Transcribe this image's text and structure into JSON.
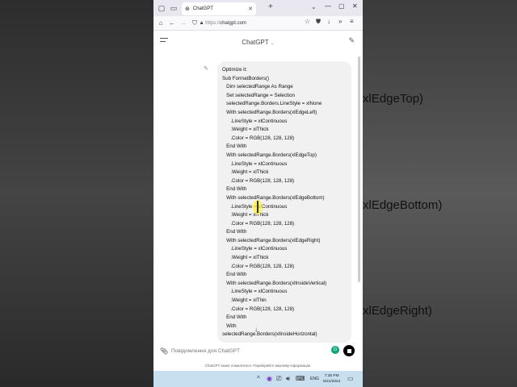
{
  "background": {
    "texts": [
      "xlEdgeTop)",
      "xlEdgeBottom)",
      "xlEdgeRight)"
    ]
  },
  "browser": {
    "tab_title": "ChatGPT",
    "url_scheme": "https://",
    "url_host": "chatgpt.com"
  },
  "chat": {
    "title": "ChatGPT",
    "message_lines": [
      "Optimize it:",
      "Sub FormatBorders()",
      "   Dim selectedRange As Range",
      "   Set selectedRange = Selection",
      "   selectedRange.Borders.LineStyle = xlNone",
      "   With selectedRange.Borders(xlEdgeLeft)",
      "      .LineStyle = xlContinuous",
      "      .Weight = xlThick",
      "      .Color = RGB(128, 128, 128)",
      "   End With",
      "   With selectedRange.Borders(xlEdgeTop)",
      "      .LineStyle = xlContinuous",
      "      .Weight = xlThick",
      "      .Color = RGB(128, 128, 128)",
      "   End With",
      "   With selectedRange.Borders(xlEdgeBottom)",
      "      .LineStyle = xlContinuous",
      "      .Weight = xlThick",
      "      .Color = RGB(128, 128, 128)",
      "   End With",
      "   With selectedRange.Borders(xlEdgeRight)",
      "      .LineStyle = xlContinuous",
      "      .Weight = xlThick",
      "      .Color = RGB(128, 128, 128)",
      "   End With",
      "   With selectedRange.Borders(xlInsideVertical)",
      "      .LineStyle = xlContinuous",
      "      .Weight = xlThin",
      "      .Color = RGB(128, 128, 128)",
      "   End With",
      "   With",
      "selectedRange.Borders(xlInsideHorizontal)"
    ],
    "input_placeholder": "Повідомлення для ChatGPT",
    "disclaimer": "ChatGPT може помилятися. Перевіряйте важливу інформацію."
  },
  "taskbar": {
    "language": "ENG",
    "time": "7:35 PM",
    "date": "5/21/2024"
  },
  "colors": {
    "accent": "#10a37f",
    "bubble": "#f1f1f1",
    "taskbar": "#c8dff0"
  }
}
